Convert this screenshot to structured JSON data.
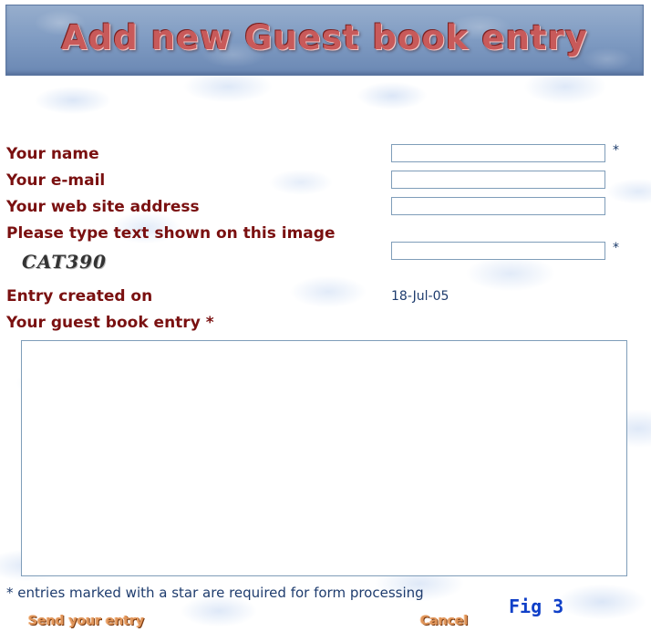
{
  "banner": {
    "title": "Add new Guest book entry"
  },
  "form": {
    "name_label": "Your name",
    "email_label": "Your e-mail",
    "website_label": "Your web site address",
    "captcha_label": "Please type text shown on this image",
    "captcha_text": "CAT390",
    "required_mark": "*",
    "created_label": "Entry created on",
    "created_value": "18-Jul-05",
    "entry_label": "Your guest book entry *",
    "name_value": "",
    "email_value": "",
    "website_value": "",
    "captcha_value": "",
    "entry_value": ""
  },
  "footer": {
    "note": "* entries marked with a star are required for form processing",
    "fig_label": "Fig 3",
    "send_label": "Send your entry",
    "cancel_label": "Cancel"
  }
}
